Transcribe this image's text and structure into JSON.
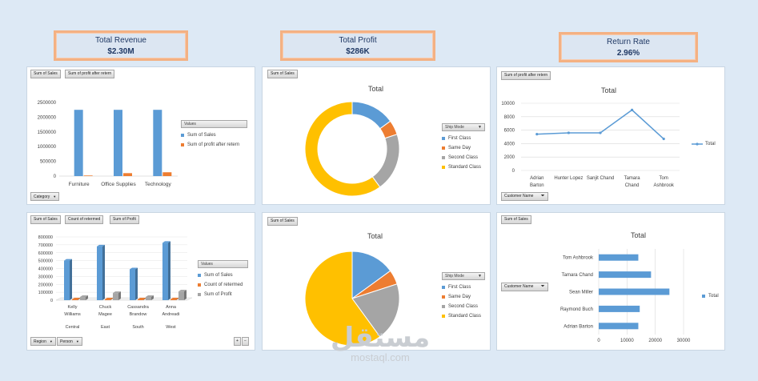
{
  "kpis": {
    "revenue": {
      "title": "Total Revenue",
      "value": "$2.30M"
    },
    "profit": {
      "title": "Total Profit",
      "value": "$286K"
    },
    "return_rate": {
      "title": "Return Rate",
      "value": "2.96%"
    }
  },
  "colors": {
    "blue": "#5b9bd5",
    "orange": "#ed7d31",
    "gray": "#a5a5a5",
    "yellow": "#ffc000"
  },
  "panel1": {
    "btn_a": "Sum of Sales",
    "btn_b": "Sum of profit after retern",
    "btn_filter": "Category",
    "legend_header": "Values",
    "legend": [
      "Sum of Sales",
      "Sum of profit after retern"
    ],
    "chart_data": {
      "type": "bar",
      "categories": [
        "Furniture",
        "Office Supplies",
        "Technology"
      ],
      "series": [
        {
          "name": "Sum of Sales",
          "values": [
            2250000,
            2250000,
            2250000
          ]
        },
        {
          "name": "Sum of profit after retern",
          "values": [
            20000,
            100000,
            130000
          ]
        }
      ],
      "ylim": [
        0,
        2500000
      ],
      "yticks": [
        "0",
        "500000",
        "1000000",
        "1500000",
        "2000000",
        "2500000"
      ]
    }
  },
  "panel2": {
    "btn_a": "Sum of Sales",
    "title": "Total",
    "legend_header": "Ship Mode",
    "legend": [
      "First Class",
      "Same Day",
      "Second Class",
      "Standard Class"
    ],
    "chart_data": {
      "type": "pie",
      "labels": [
        "First Class",
        "Same Day",
        "Second Class",
        "Standard Class"
      ],
      "values": [
        15,
        5,
        20,
        60
      ]
    }
  },
  "panel3": {
    "btn_a": "Sum of profit after retern",
    "title": "Total",
    "btn_filter": "Customer Name",
    "legend": [
      "Total"
    ],
    "chart_data": {
      "type": "line",
      "categories": [
        "Adrian Barton",
        "Hunter Lopez",
        "Sanjit Chand",
        "Tamara Chand",
        "Tom Ashbrook"
      ],
      "cat_lines": [
        [
          "Adrian",
          "Barton"
        ],
        [
          "Hunter Lopez"
        ],
        [
          "Sanjit Chand"
        ],
        [
          "Tamara",
          "Chand"
        ],
        [
          "Tom",
          "Ashbrook"
        ]
      ],
      "series": [
        {
          "name": "Total",
          "values": [
            5400,
            5600,
            5600,
            9000,
            4700
          ]
        }
      ],
      "ylim": [
        0,
        10000
      ],
      "yticks": [
        "0",
        "2000",
        "4000",
        "6000",
        "8000",
        "10000"
      ]
    }
  },
  "panel4": {
    "btn_a": "Sum of Sales",
    "btn_b": "Count of retermed",
    "btn_c": "Sum of Profit",
    "btn_f1": "Region",
    "btn_f2": "Person",
    "legend_header": "Values",
    "legend": [
      "Sum of Sales",
      "Count of retermed",
      "Sum of Profit"
    ],
    "chart_data": {
      "type": "bar",
      "categories": [
        "Kelly Williams",
        "Chuck Magee",
        "Cassandra Brandow",
        "Anna Andreadi"
      ],
      "cat_lines": [
        [
          "Kelly",
          "Williams"
        ],
        [
          "Chuck",
          "Magee"
        ],
        [
          "Cassandra",
          "Brandow"
        ],
        [
          "Anna",
          "Andreadi"
        ]
      ],
      "groups": [
        "Central",
        "East",
        "South",
        "West"
      ],
      "series": [
        {
          "name": "Sum of Sales",
          "values": [
            500000,
            680000,
            390000,
            725000
          ]
        },
        {
          "name": "Count of retermed",
          "values": [
            10000,
            10000,
            10000,
            10000
          ]
        },
        {
          "name": "Sum of Profit",
          "values": [
            40000,
            90000,
            40000,
            110000
          ]
        }
      ],
      "ylim": [
        0,
        800000
      ],
      "yticks": [
        "0",
        "100000",
        "200000",
        "300000",
        "400000",
        "500000",
        "600000",
        "700000",
        "800000"
      ]
    }
  },
  "panel5": {
    "btn_a": "Sum of Sales",
    "title": "Total",
    "legend_header": "Ship Mode",
    "legend": [
      "First Class",
      "Same Day",
      "Second Class",
      "Standard Class"
    ],
    "chart_data": {
      "type": "pie",
      "labels": [
        "First Class",
        "Same Day",
        "Second Class",
        "Standard Class"
      ],
      "values": [
        15,
        5,
        20,
        60
      ]
    }
  },
  "panel6": {
    "btn_a": "Sum of Sales",
    "title": "Total",
    "btn_filter": "Customer Name",
    "legend": [
      "Total"
    ],
    "chart_data": {
      "type": "bar",
      "categories": [
        "Tom Ashbrook",
        "Tamara Chand",
        "Sean Miller",
        "Raymond Buch",
        "Adrian Barton"
      ],
      "series": [
        {
          "name": "Total",
          "values": [
            14000,
            18500,
            25000,
            14500,
            14000
          ]
        }
      ],
      "xlim": [
        0,
        30000
      ],
      "xticks": [
        "0",
        "10000",
        "20000",
        "30000"
      ]
    }
  },
  "watermark": {
    "arabic": "مستقل",
    "latin": "mostaql.com"
  }
}
